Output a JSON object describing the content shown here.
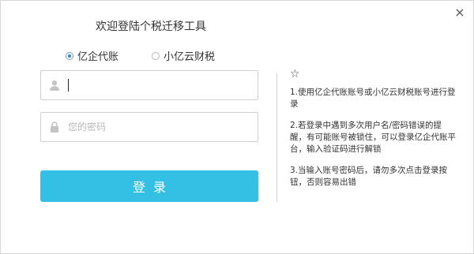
{
  "window": {
    "title": "欢迎登陆个税迁移工具",
    "close_symbol": "×"
  },
  "account_type": {
    "options": [
      {
        "label": "亿企代账",
        "checked": true
      },
      {
        "label": "小亿云财税",
        "checked": false
      }
    ]
  },
  "form": {
    "username_value": "",
    "password_placeholder": "您的密码",
    "login_label": "登录"
  },
  "tips": {
    "star_icon": "☆",
    "items": [
      "1.使用亿企代账账号或小亿云财税账号进行登录",
      "2.若登录中遇到多次用户名/密码错误的提醒，有可能账号被锁住，可以登录亿企代账平台，输入验证码进行解锁",
      "3.当输入账号密码后，请勿多次点击登录按钮，否则容易出错"
    ]
  },
  "colors": {
    "accent": "#33c0e4",
    "radio_checked": "#3d7fb7"
  }
}
